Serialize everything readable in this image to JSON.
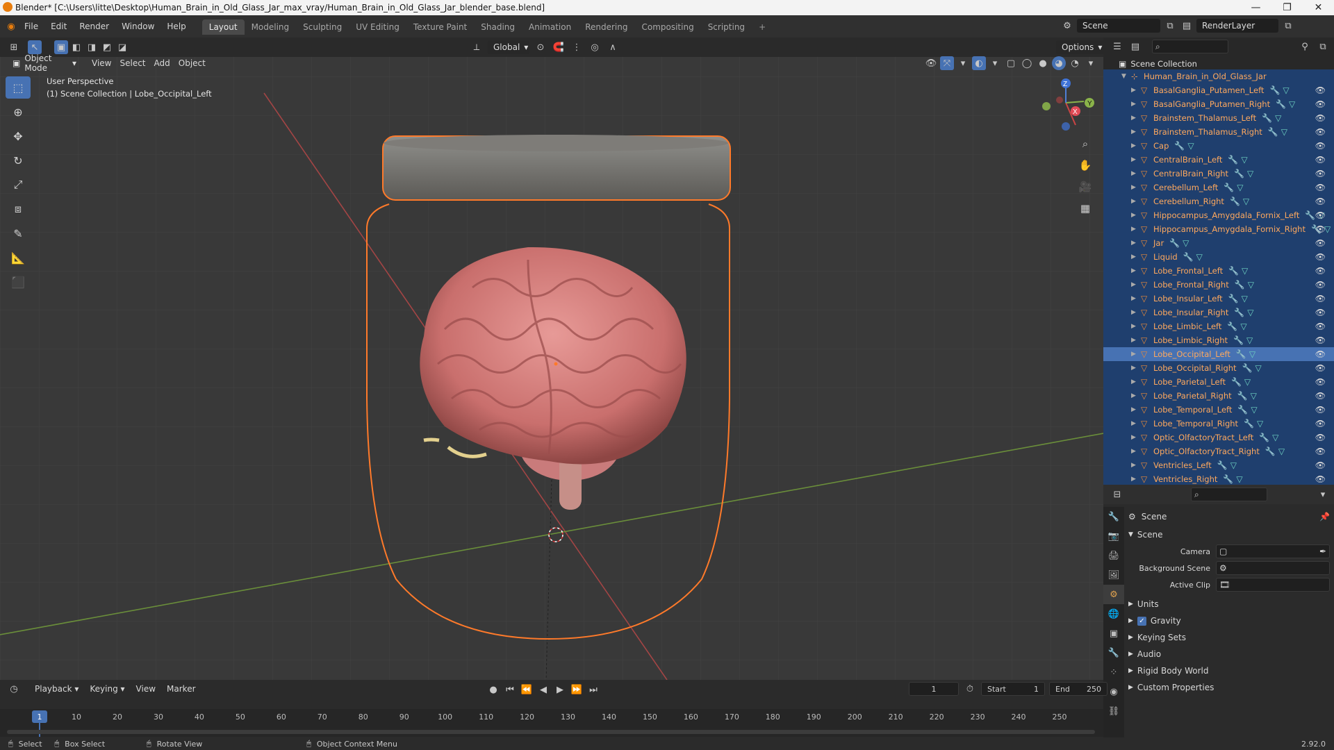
{
  "window": {
    "title": "Blender* [C:\\Users\\litte\\Desktop\\Human_Brain_in_Old_Glass_Jar_max_vray/Human_Brain_in_Old_Glass_Jar_blender_base.blend]"
  },
  "menu": [
    "File",
    "Edit",
    "Render",
    "Window",
    "Help"
  ],
  "workspaces": [
    "Layout",
    "Modeling",
    "Sculpting",
    "UV Editing",
    "Texture Paint",
    "Shading",
    "Animation",
    "Rendering",
    "Compositing",
    "Scripting"
  ],
  "scene_field": "Scene",
  "renderlayer_field": "RenderLayer",
  "viewport": {
    "transform_orientation": "Global",
    "options_label": "Options",
    "mode": "Object Mode",
    "header_menus": [
      "View",
      "Select",
      "Add",
      "Object"
    ],
    "overlay_line1": "User Perspective",
    "overlay_line2": "(1) Scene Collection | Lobe_Occipital_Left",
    "gizmo_axes": [
      "X",
      "Y",
      "Z"
    ]
  },
  "outliner": {
    "root": "Scene Collection",
    "parent": "Human_Brain_in_Old_Glass_Jar",
    "selected": "Lobe_Occipital_Left",
    "items": [
      "BasalGanglia_Putamen_Left",
      "BasalGanglia_Putamen_Right",
      "Brainstem_Thalamus_Left",
      "Brainstem_Thalamus_Right",
      "Cap",
      "CentralBrain_Left",
      "CentralBrain_Right",
      "Cerebellum_Left",
      "Cerebellum_Right",
      "Hippocampus_Amygdala_Fornix_Left",
      "Hippocampus_Amygdala_Fornix_Right",
      "Jar",
      "Liquid",
      "Lobe_Frontal_Left",
      "Lobe_Frontal_Right",
      "Lobe_Insular_Left",
      "Lobe_Insular_Right",
      "Lobe_Limbic_Left",
      "Lobe_Limbic_Right",
      "Lobe_Occipital_Left",
      "Lobe_Occipital_Right",
      "Lobe_Parietal_Left",
      "Lobe_Parietal_Right",
      "Lobe_Temporal_Left",
      "Lobe_Temporal_Right",
      "Optic_OlfactoryTract_Left",
      "Optic_OlfactoryTract_Right",
      "Ventricles_Left",
      "Ventricles_Right"
    ]
  },
  "properties": {
    "context": "Scene",
    "panel": "Scene",
    "camera_label": "Camera",
    "background_label": "Background Scene",
    "clip_label": "Active Clip",
    "sections": [
      "Units",
      "Gravity",
      "Keying Sets",
      "Audio",
      "Rigid Body World",
      "Custom Properties"
    ],
    "gravity_checked": true
  },
  "timeline": {
    "menus": [
      "Playback",
      "Keying",
      "View",
      "Marker"
    ],
    "current_frame": "1",
    "start_label": "Start",
    "start_value": "1",
    "end_label": "End",
    "end_value": "250",
    "ticks": [
      "1",
      "10",
      "20",
      "30",
      "40",
      "50",
      "60",
      "70",
      "80",
      "90",
      "100",
      "110",
      "120",
      "130",
      "140",
      "150",
      "160",
      "170",
      "180",
      "190",
      "200",
      "210",
      "220",
      "230",
      "240",
      "250"
    ]
  },
  "status": {
    "select": "Select",
    "box_select": "Box Select",
    "rotate": "Rotate View",
    "context_menu": "Object Context Menu",
    "version": "2.92.0"
  },
  "colors": {
    "accent": "#4772b3",
    "outliner_text": "#ffa95e",
    "selection_outline": "#ff7a2a"
  }
}
